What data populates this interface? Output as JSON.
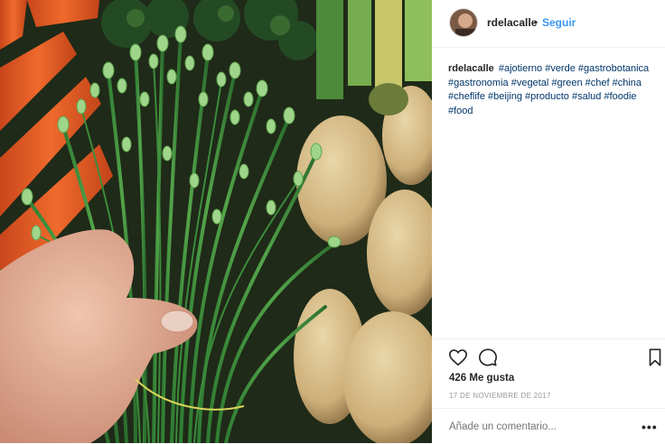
{
  "post": {
    "image_alt": "Manojo de flores de ajo tierno sostenido en la mano junto a zanahorias y papas",
    "icons": {
      "like": "heart-icon",
      "comment": "comment-bubble-icon",
      "save": "bookmark-icon",
      "more": "more-options-icon"
    }
  },
  "header": {
    "username": "rdelacalle",
    "separator": "•",
    "follow_label": "Seguir"
  },
  "caption": {
    "username": "rdelacalle",
    "hashtags": "#ajotierno #verde #gastrobotanica #gastronomia #vegetal #green #chef #china #cheflife #beijing #producto #salud #foodie #food"
  },
  "stats": {
    "likes": "426 Me gusta",
    "date": "17 DE NOVIEMBRE DE 2017"
  },
  "comment": {
    "placeholder": "Añade un comentario...",
    "more_label": "•••"
  },
  "colors": {
    "link_blue": "#3897f0",
    "text": "#262626",
    "muted": "#999999",
    "hashtag": "#003569"
  }
}
